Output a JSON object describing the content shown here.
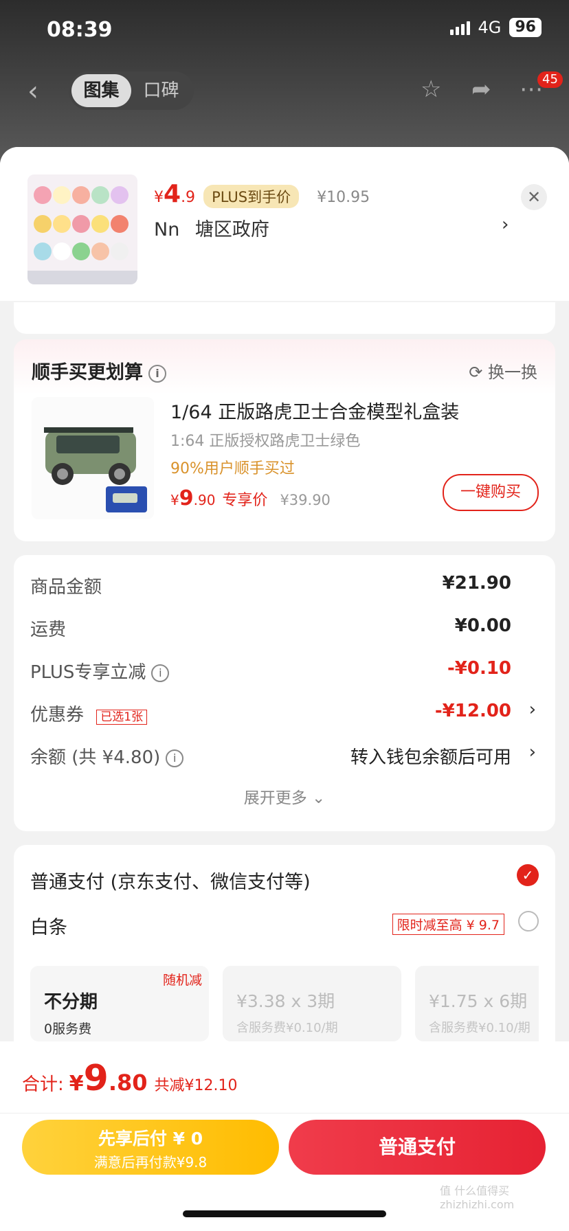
{
  "status": {
    "time": "08:39",
    "network": "4G",
    "battery": "96"
  },
  "nav": {
    "tabs": [
      "图集",
      "口碑"
    ],
    "active_tab": "图集",
    "badge": "45"
  },
  "product": {
    "price_symbol": "¥",
    "price_int": "4",
    "price_dec": ".9",
    "plus_tag": "PLUS到手价",
    "orig_price": "¥10.95",
    "address_name": "Nn",
    "address": "塘区政府"
  },
  "addon": {
    "title": "顺手买更划算",
    "refresh": "换一换",
    "item_title": "1/64 正版路虎卫士合金模型礼盒装",
    "item_sub": "1:64 正版授权路虎卫士绿色",
    "item_social": "90%用户顺手买过",
    "price_int": "9",
    "price_dec": ".90",
    "price_tag": "专享价",
    "orig_price": "¥39.90",
    "buy_button": "一键购买"
  },
  "summary": {
    "goods_label": "商品金额",
    "goods_value": "¥21.90",
    "ship_label": "运费",
    "ship_value": "¥0.00",
    "plus_label": "PLUS专享立减",
    "plus_value": "-¥0.10",
    "coupon_label": "优惠券",
    "coupon_tag": "已选1张",
    "coupon_value": "-¥12.00",
    "balance_label": "余额 (共 ¥4.80)",
    "balance_value": "转入钱包余额后可用",
    "expand": "展开更多"
  },
  "payment": {
    "normal_label": "普通支付 (京东支付、微信支付等)",
    "baitiao_label": "白条",
    "baitiao_tag": "限时减至高 ¥ 9.7",
    "plans": [
      {
        "title": "不分期",
        "sub": "0服务费",
        "tag": "随机减"
      },
      {
        "title": "¥3.38 x 3期",
        "sub": "含服务费¥0.10/期"
      },
      {
        "title": "¥1.75 x 6期",
        "sub": "含服务费¥0.10/期"
      }
    ]
  },
  "footer": {
    "total_label": "合计:",
    "total_symbol": "¥",
    "total_int": "9",
    "total_dec": ".80",
    "discount": "共减¥12.10",
    "later_line1": "先享后付 ¥ 0",
    "later_line2": "满意后再付款¥9.8",
    "pay_button": "普通支付"
  },
  "watermark": "值 什么值得买 zhizhizhi.com",
  "colors": {
    "accent": "#e2231a",
    "yellow": "#ffc000",
    "plus": "#f7e6b5"
  }
}
